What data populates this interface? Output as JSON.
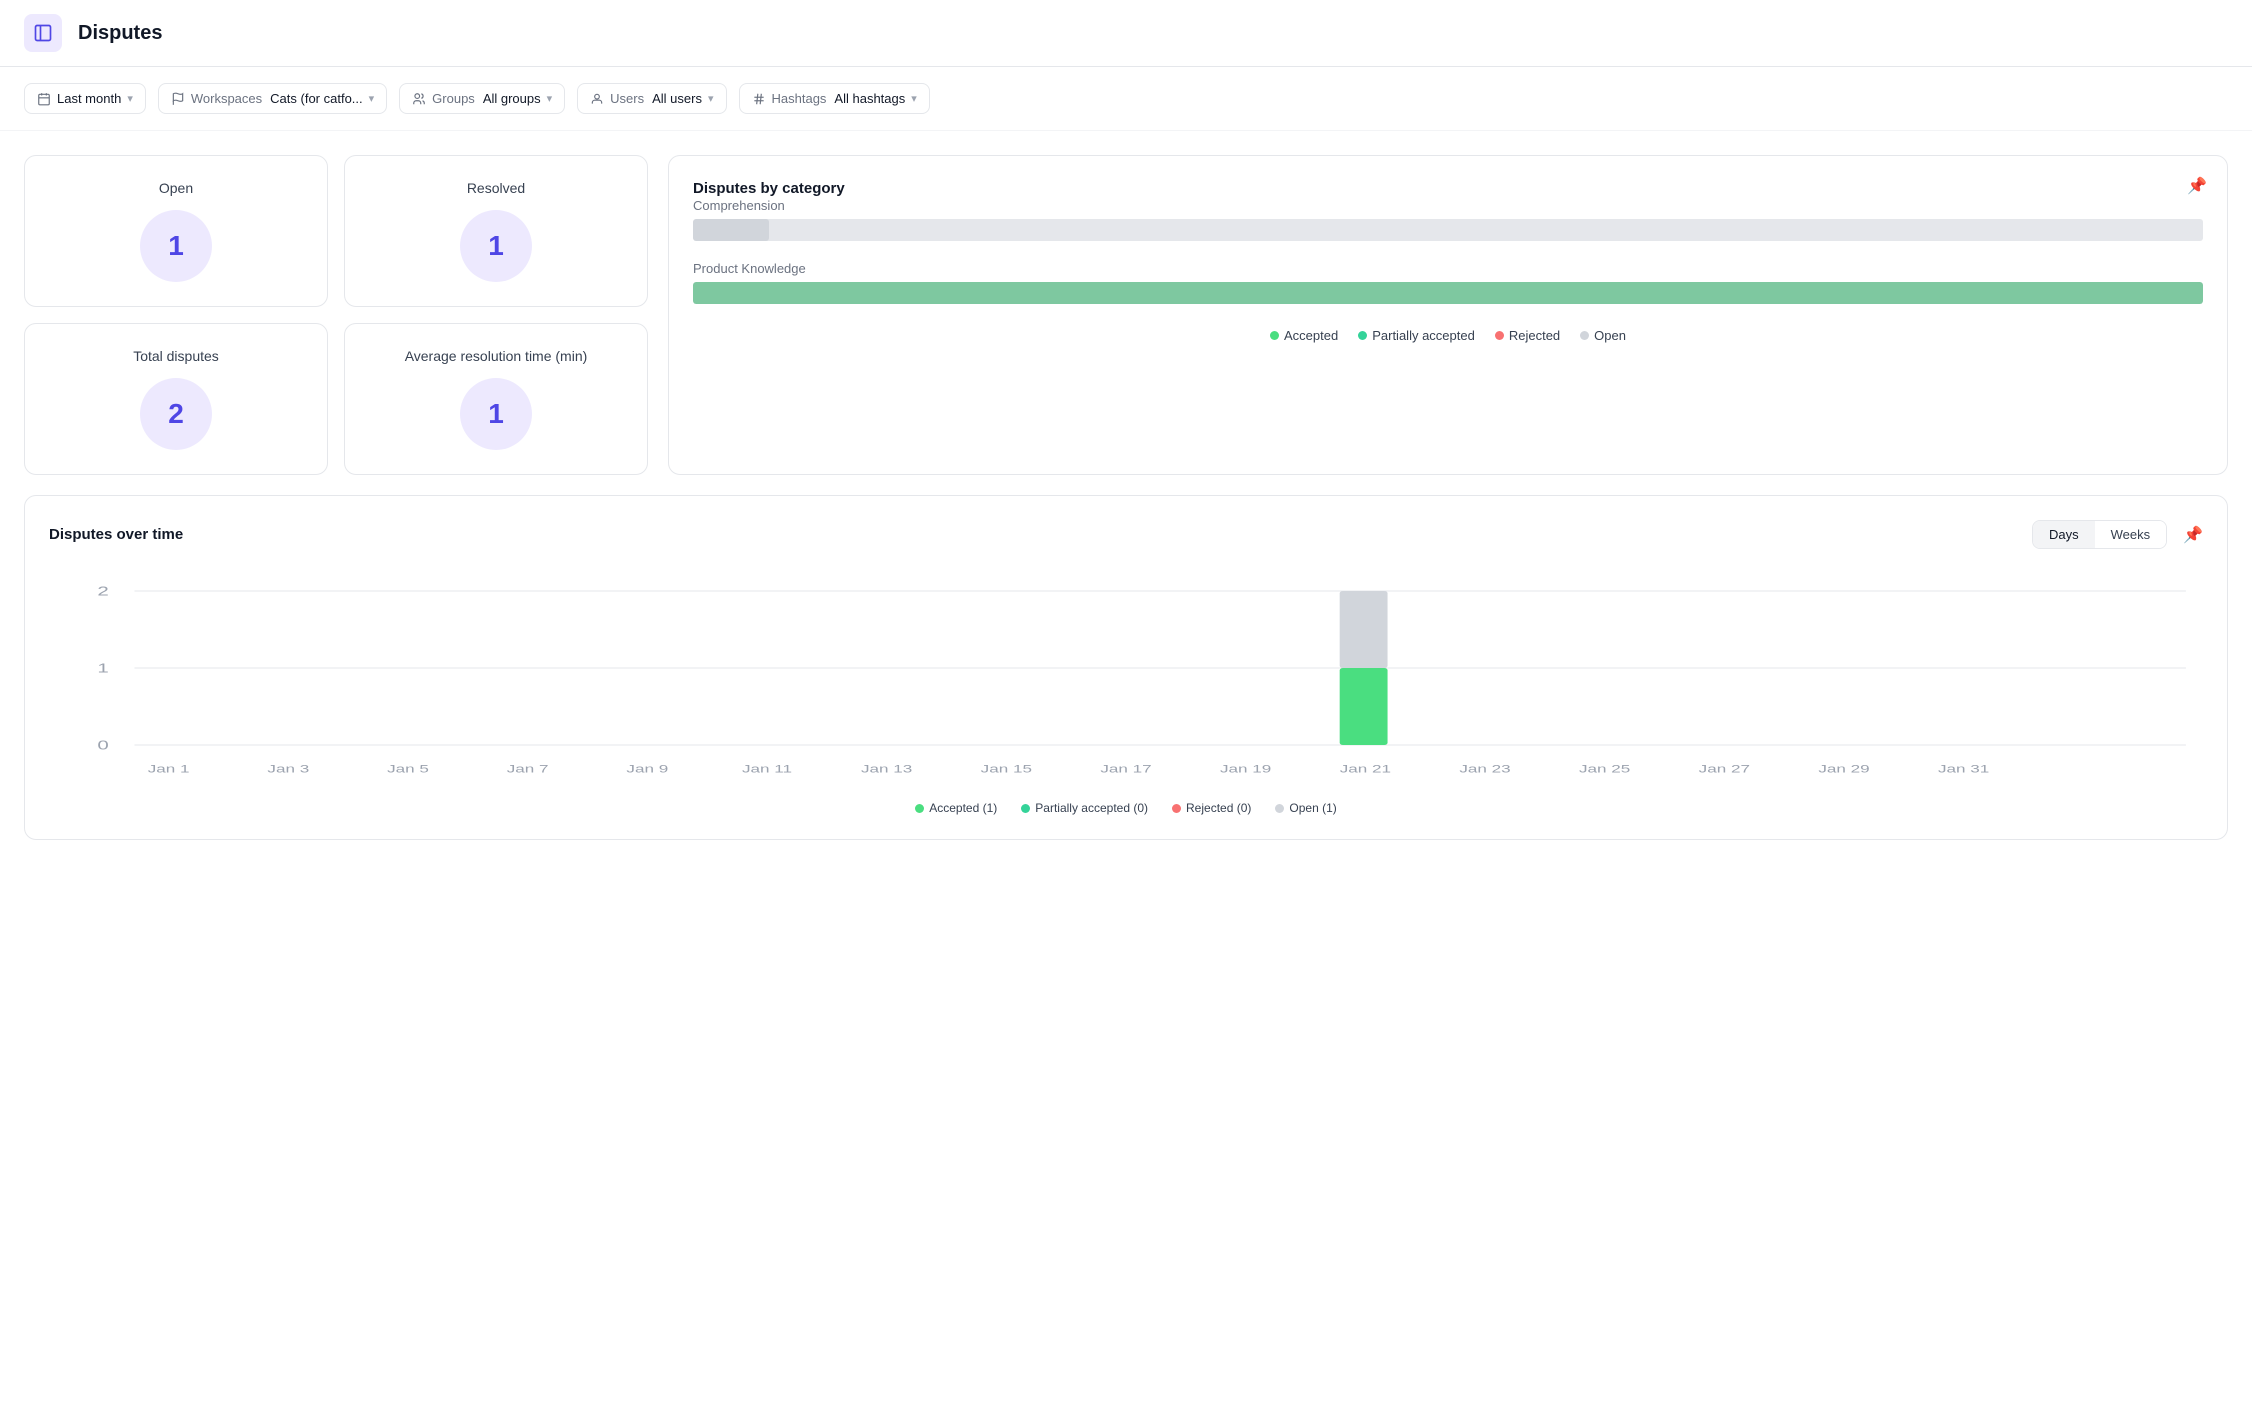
{
  "header": {
    "icon": "sidebar-icon",
    "title": "Disputes"
  },
  "filters": {
    "time": {
      "label": "",
      "value": "Last month",
      "icon": "calendar-icon"
    },
    "workspaces": {
      "label": "Workspaces",
      "value": "Cats (for catfo...",
      "icon": "flag-icon"
    },
    "groups": {
      "label": "Groups",
      "value": "All groups",
      "icon": "groups-icon"
    },
    "users": {
      "label": "Users",
      "value": "All users",
      "icon": "users-icon"
    },
    "hashtags": {
      "label": "Hashtags",
      "value": "All hashtags",
      "icon": "hashtag-icon"
    }
  },
  "stats": {
    "open": {
      "label": "Open",
      "value": "1"
    },
    "resolved": {
      "label": "Resolved",
      "value": "1"
    },
    "total": {
      "label": "Total disputes",
      "value": "2"
    },
    "avg_resolution": {
      "label": "Average resolution time (min)",
      "value": "1"
    }
  },
  "disputes_by_category": {
    "title": "Disputes by category",
    "categories": [
      {
        "name": "Comprehension",
        "fill_pct": 5,
        "color": "gray"
      },
      {
        "name": "Product Knowledge",
        "fill_pct": 100,
        "color": "green"
      }
    ],
    "legend": [
      {
        "label": "Accepted",
        "color": "accepted"
      },
      {
        "label": "Partially accepted",
        "color": "partial"
      },
      {
        "label": "Rejected",
        "color": "rejected"
      },
      {
        "label": "Open",
        "color": "open"
      }
    ]
  },
  "disputes_over_time": {
    "title": "Disputes over time",
    "toggle": {
      "days_label": "Days",
      "weeks_label": "Weeks"
    },
    "y_labels": [
      "2",
      "1",
      "0"
    ],
    "x_labels": [
      "Jan 1",
      "Jan 3",
      "Jan 5",
      "Jan 7",
      "Jan 9",
      "Jan 11",
      "Jan 13",
      "Jan 15",
      "Jan 17",
      "Jan 19",
      "Jan 21",
      "Jan 23",
      "Jan 25",
      "Jan 27",
      "Jan 29",
      "Jan 31"
    ],
    "legend": [
      {
        "label": "Accepted (1)",
        "color": "accepted"
      },
      {
        "label": "Partially accepted (0)",
        "color": "partial"
      },
      {
        "label": "Rejected (0)",
        "color": "rejected"
      },
      {
        "label": "Open (1)",
        "color": "open"
      }
    ]
  }
}
